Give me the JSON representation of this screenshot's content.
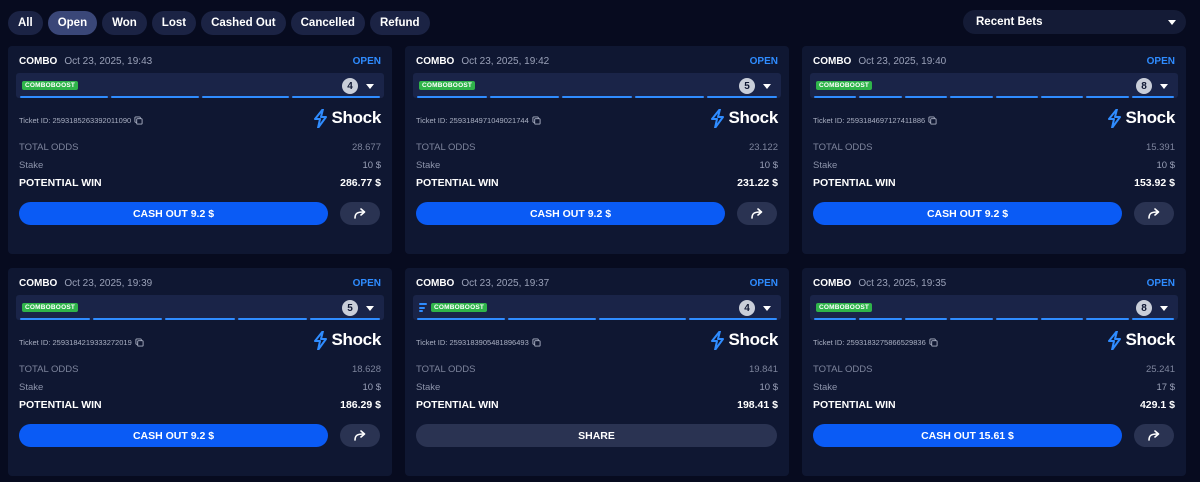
{
  "filters": [
    "All",
    "Open",
    "Won",
    "Lost",
    "Cashed Out",
    "Cancelled",
    "Refund"
  ],
  "active_filter": "Open",
  "recent_dropdown": {
    "label": "Recent Bets"
  },
  "labels": {
    "ticket_prefix": "Ticket ID: ",
    "total_odds": "TOTAL ODDS",
    "stake": "Stake",
    "potential_win": "POTENTIAL WIN",
    "share": "SHARE"
  },
  "brand": {
    "name": "Shock",
    "color": "#2f8cff"
  },
  "colors": {
    "accent": "#0a5bf5",
    "boost_badge": "#2fb44a",
    "open_status": "#2f8cff"
  },
  "bets": [
    {
      "type": "COMBO",
      "date": "Oct 23, 2025, 19:43",
      "status": "OPEN",
      "boost": "COMBOBOOST",
      "boost_icon": false,
      "legs": "4",
      "ticket_id": "2593185263392011090",
      "total_odds": "28.677",
      "stake": "10 $",
      "potential_win": "286.77 $",
      "cashout": "CASH OUT 9.2 $"
    },
    {
      "type": "COMBO",
      "date": "Oct 23, 2025, 19:42",
      "status": "OPEN",
      "boost": "COMBOBOOST",
      "boost_icon": false,
      "legs": "5",
      "ticket_id": "2593184971049021744",
      "total_odds": "23.122",
      "stake": "10 $",
      "potential_win": "231.22 $",
      "cashout": "CASH OUT 9.2 $"
    },
    {
      "type": "COMBO",
      "date": "Oct 23, 2025, 19:40",
      "status": "OPEN",
      "boost": "COMBOBOOST",
      "boost_icon": false,
      "legs": "8",
      "ticket_id": "2593184697127411886",
      "total_odds": "15.391",
      "stake": "10 $",
      "potential_win": "153.92 $",
      "cashout": "CASH OUT 9.2 $"
    },
    {
      "type": "COMBO",
      "date": "Oct 23, 2025, 19:39",
      "status": "OPEN",
      "boost": "COMBOBOOST",
      "boost_icon": false,
      "legs": "5",
      "ticket_id": "2593184219333272019",
      "total_odds": "18.628",
      "stake": "10 $",
      "potential_win": "186.29 $",
      "cashout": "CASH OUT 9.2 $"
    },
    {
      "type": "COMBO",
      "date": "Oct 23, 2025, 19:37",
      "status": "OPEN",
      "boost": "COMBOBOOST",
      "boost_icon": true,
      "legs": "4",
      "ticket_id": "2593183905481896493",
      "total_odds": "19.841",
      "stake": "10 $",
      "potential_win": "198.41 $",
      "cashout": null
    },
    {
      "type": "COMBO",
      "date": "Oct 23, 2025, 19:35",
      "status": "OPEN",
      "boost": "COMBOBOOST",
      "boost_icon": false,
      "legs": "8",
      "ticket_id": "2593183275866529836",
      "total_odds": "25.241",
      "stake": "17 $",
      "potential_win": "429.1 $",
      "cashout": "CASH OUT 15.61 $"
    }
  ]
}
